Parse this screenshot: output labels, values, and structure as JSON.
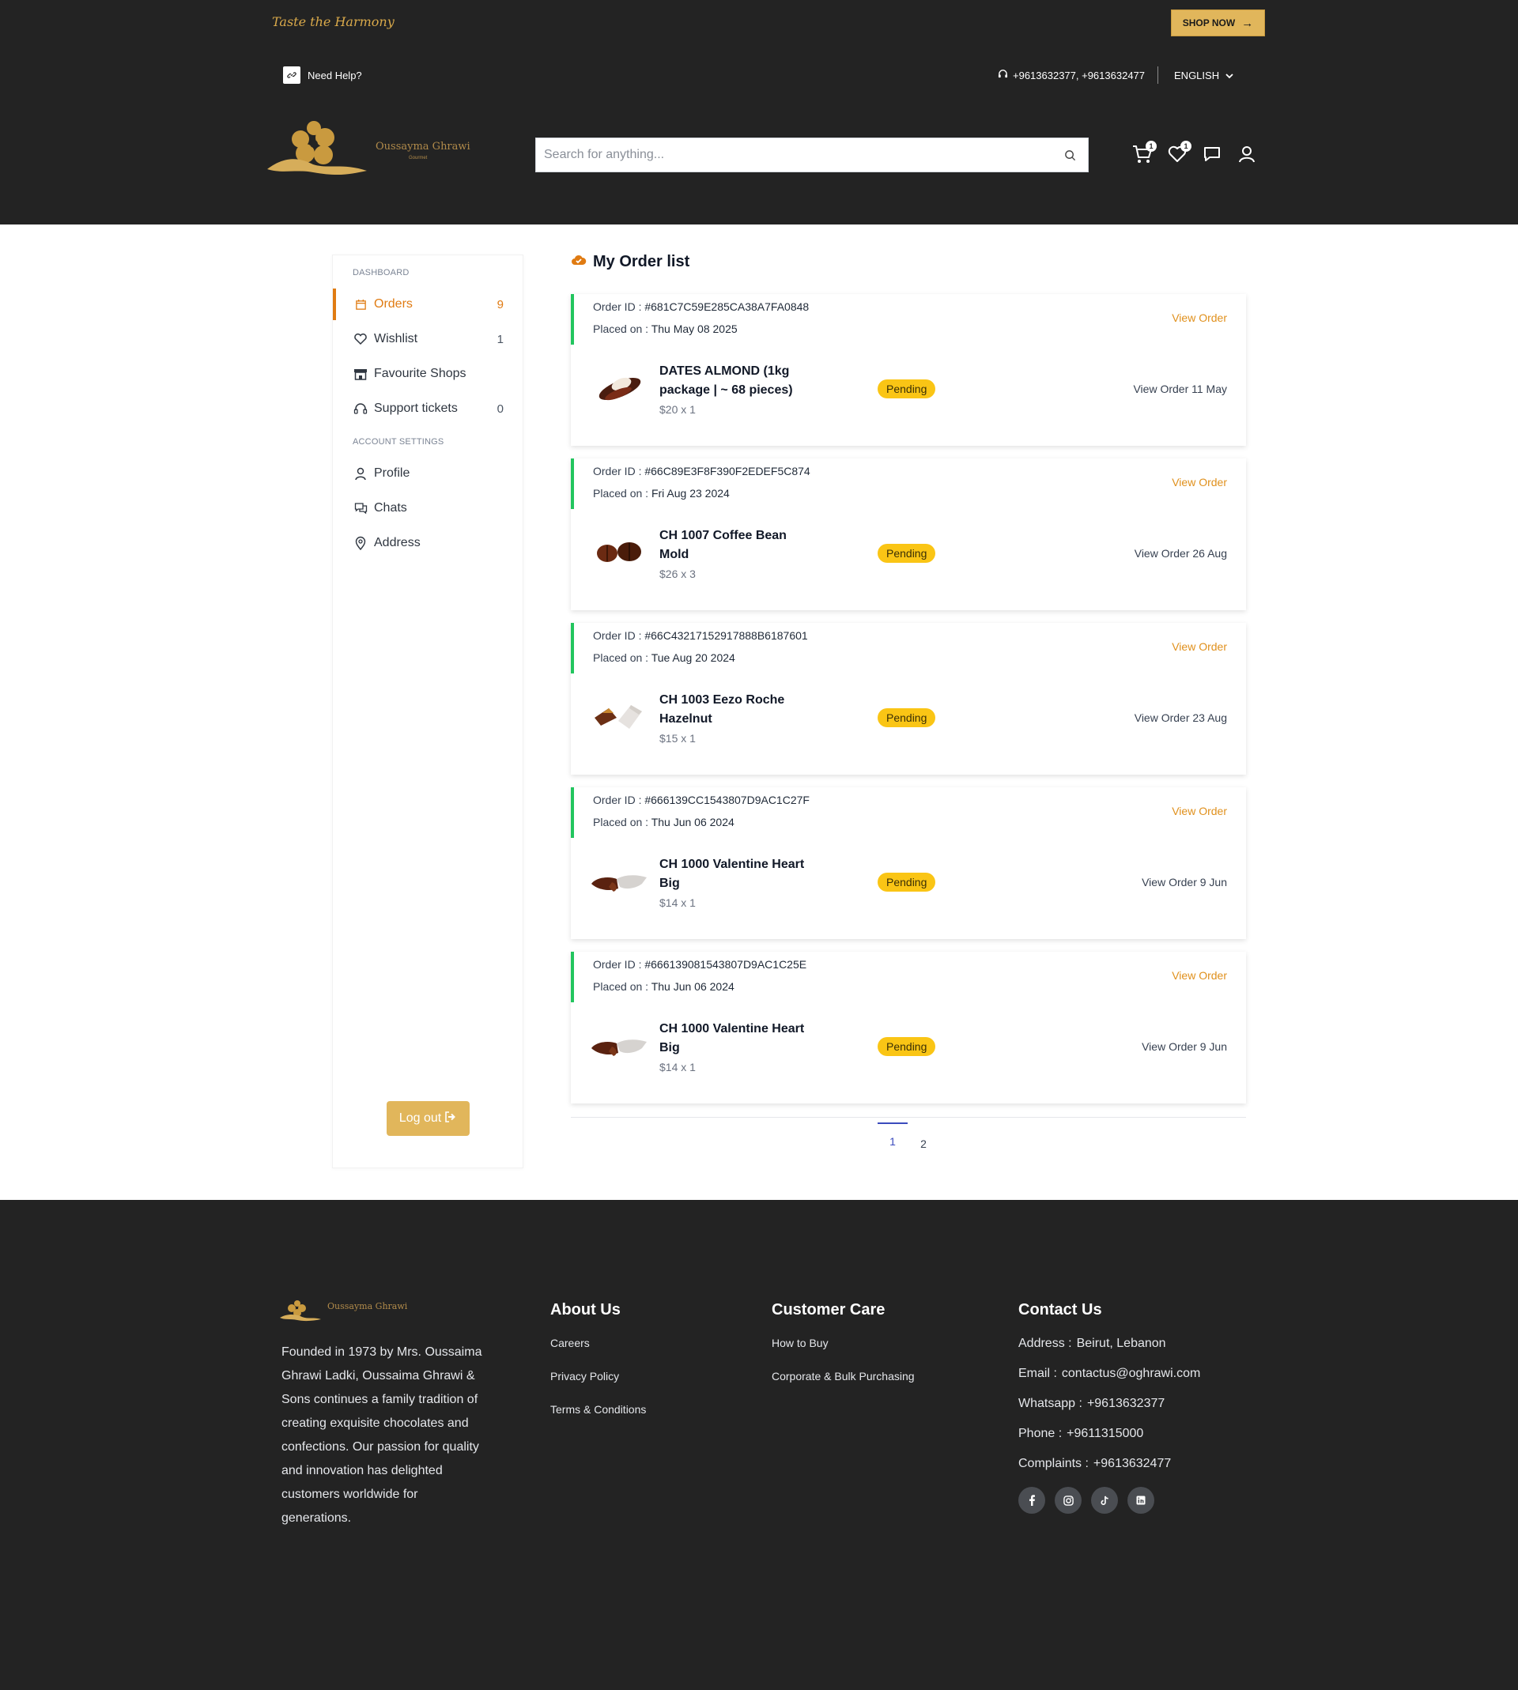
{
  "topbar": {
    "tagline": "Taste the Harmony",
    "shop_now": "SHOP NOW",
    "need_help": "Need Help?",
    "phones": "+9613632377, +9613632477",
    "language": "ENGLISH"
  },
  "brand": {
    "name": "Oussayma Ghrawi",
    "sub": "Gourmet"
  },
  "search": {
    "placeholder": "Search for anything..."
  },
  "header_icons": {
    "cart_count": "1",
    "wishlist_count": "1"
  },
  "sidebar": {
    "dashboard_heading": "DASHBOARD",
    "account_heading": "ACCOUNT SETTINGS",
    "items": [
      {
        "label": "Orders",
        "count": "9",
        "icon": "calendar-icon"
      },
      {
        "label": "Wishlist",
        "count": "1",
        "icon": "heart-icon"
      },
      {
        "label": "Favourite Shops",
        "count": "",
        "icon": "store-icon"
      },
      {
        "label": "Support tickets",
        "count": "0",
        "icon": "headset-icon"
      }
    ],
    "account_items": [
      {
        "label": "Profile",
        "icon": "user-icon"
      },
      {
        "label": "Chats",
        "icon": "chat-icon"
      },
      {
        "label": "Address",
        "icon": "map-pin-icon"
      }
    ],
    "logout": "Log out"
  },
  "main": {
    "title": "My Order list",
    "order_id_label": "Order ID :",
    "placed_label": "Placed on :",
    "view_order": "View Order",
    "orders": [
      {
        "id": "#681C7C59E285CA38A7FA0848",
        "placed": "Thu May 08 2025",
        "name": "DATES ALMOND (1kg package | ~ 68 pieces)",
        "price": "$20 x 1",
        "status": "Pending",
        "right": "View Order 11 May"
      },
      {
        "id": "#66C89E3F8F390F2EDEF5C874",
        "placed": "Fri Aug 23 2024",
        "name": "CH 1007 Coffee Bean Mold",
        "price": "$26 x 3",
        "status": "Pending",
        "right": "View Order 26 Aug"
      },
      {
        "id": "#66C43217152917888B6187601",
        "placed": "Tue Aug 20 2024",
        "name": "CH 1003 Eezo Roche Hazelnut",
        "price": "$15 x 1",
        "status": "Pending",
        "right": "View Order 23 Aug"
      },
      {
        "id": "#666139CC1543807D9AC1C27F",
        "placed": "Thu Jun 06 2024",
        "name": "CH 1000 Valentine Heart Big",
        "price": "$14 x 1",
        "status": "Pending",
        "right": "View Order 9 Jun"
      },
      {
        "id": "#666139081543807D9AC1C25E",
        "placed": "Thu Jun 06 2024",
        "name": "CH 1000 Valentine Heart Big",
        "price": "$14 x 1",
        "status": "Pending",
        "right": "View Order 9 Jun"
      }
    ],
    "pages": [
      "1",
      "2"
    ],
    "current_page": "1"
  },
  "footer": {
    "about_text": "Founded in 1973 by Mrs. Oussaima Ghrawi Ladki, Oussaima Ghrawi & Sons continues a family tradition of creating exquisite chocolates and confections. Our passion for quality and innovation has delighted customers worldwide for generations.",
    "about_heading": "About Us",
    "about_links": [
      "Careers",
      "Privacy Policy",
      "Terms & Conditions"
    ],
    "care_heading": "Customer Care",
    "care_links": [
      "How to Buy",
      "Corporate & Bulk Purchasing"
    ],
    "contact_heading": "Contact Us",
    "contact": [
      {
        "label": "Address :",
        "value": "Beirut, Lebanon"
      },
      {
        "label": "Email :",
        "value": "contactus@oghrawi.com"
      },
      {
        "label": "Whatsapp :",
        "value": "+9613632377"
      },
      {
        "label": "Phone :",
        "value": "+9611315000"
      },
      {
        "label": "Complaints :",
        "value": "+9613632477"
      }
    ],
    "socials": [
      "facebook-icon",
      "instagram-icon",
      "tiktok-icon",
      "linkedin-icon"
    ]
  },
  "colors": {
    "accent": "#e07b12",
    "gold": "#e1b65b",
    "status": "#fac515",
    "header_bg": "#232323",
    "card_bar": "#22c55e"
  }
}
